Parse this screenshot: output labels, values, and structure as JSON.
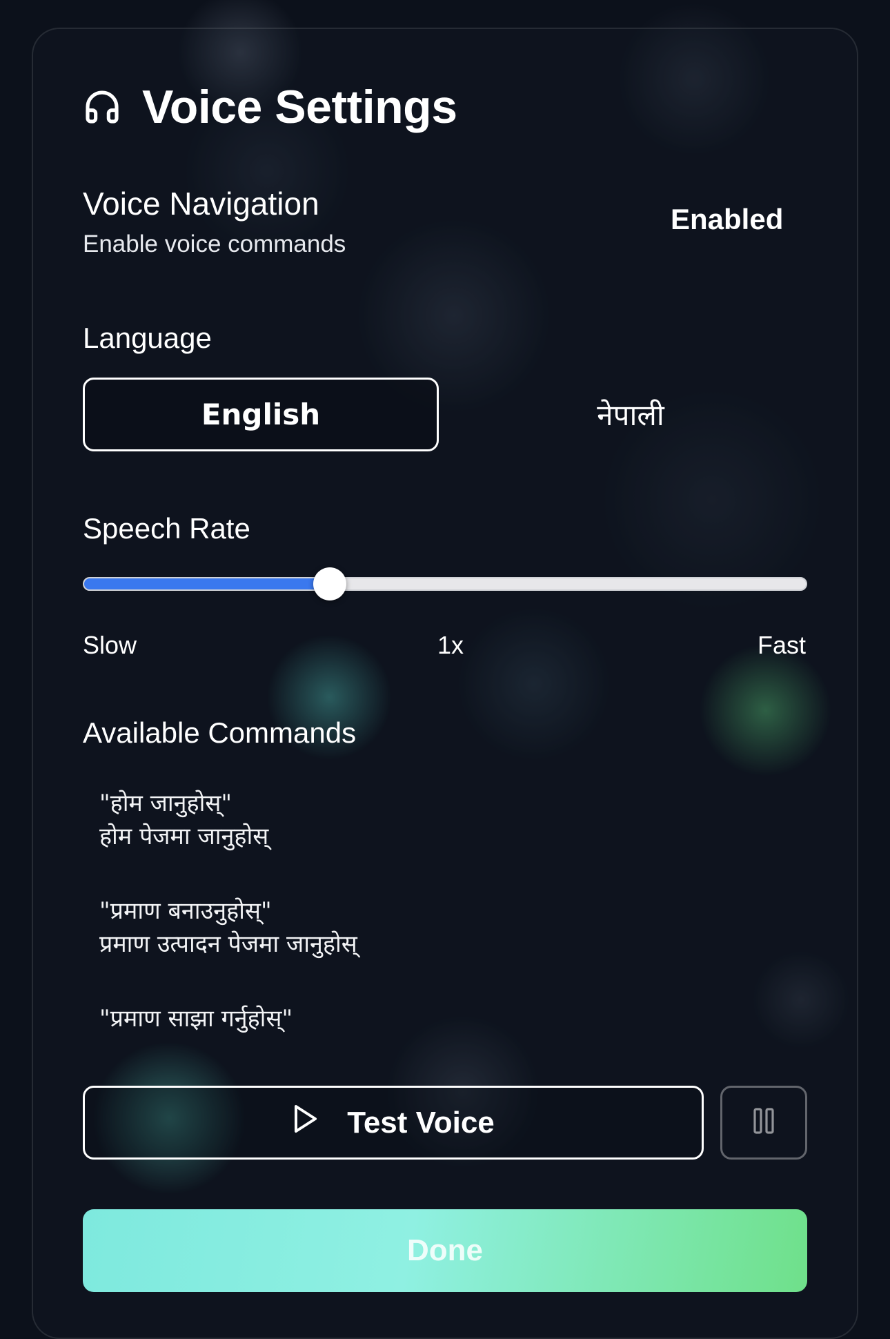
{
  "header": {
    "title": "Voice Settings",
    "icon": "headphones-icon"
  },
  "voice_navigation": {
    "title": "Voice Navigation",
    "subtitle": "Enable voice commands",
    "status": "Enabled"
  },
  "language": {
    "label": "Language",
    "options": [
      "English",
      "नेपाली"
    ],
    "selected": "English"
  },
  "speech_rate": {
    "label": "Speech Rate",
    "min_label": "Slow",
    "current_label": "1x",
    "max_label": "Fast",
    "value_fraction": 0.34,
    "fill_color": "#3a78ee"
  },
  "commands": {
    "label": "Available Commands",
    "items": [
      {
        "phrase": "\"होम जानुहोस्\"",
        "description": "होम पेजमा जानुहोस्"
      },
      {
        "phrase": "\"प्रमाण बनाउनुहोस्\"",
        "description": "प्रमाण उत्पादन पेजमा जानुहोस्"
      },
      {
        "phrase": "\"प्रमाण साझा गर्नुहोस्\"",
        "description": ""
      }
    ]
  },
  "actions": {
    "test_voice_label": "Test Voice",
    "test_voice_icon": "play-icon",
    "pause_icon": "pause-icon",
    "done_label": "Done"
  },
  "colors": {
    "background": "#0c111b",
    "accent_gradient_start": "#7ee9de",
    "accent_gradient_end": "#6fe08a",
    "slider_fill": "#3a78ee"
  }
}
